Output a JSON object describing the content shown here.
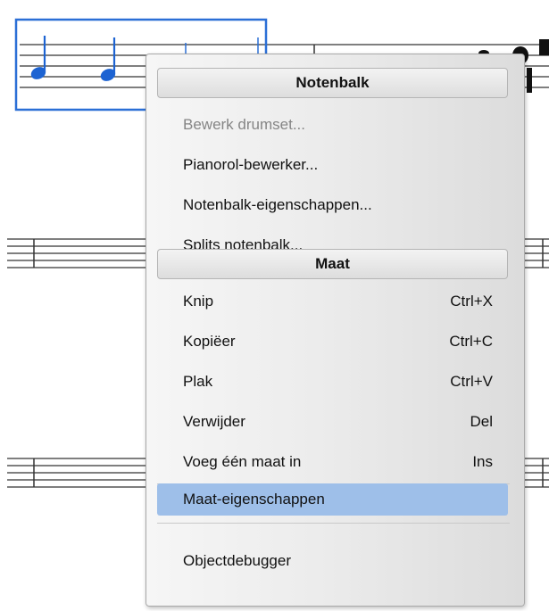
{
  "context_menu": {
    "staff_header": "Notenbalk",
    "staff_items": [
      {
        "label": "Bewerk drumset...",
        "disabled": true
      },
      {
        "label": "Pianorol-bewerker..."
      },
      {
        "label": "Notenbalk-eigenschappen..."
      },
      {
        "label": "Splits notenbalk..."
      }
    ],
    "measure_header": "Maat",
    "measure_items": [
      {
        "label": "Knip",
        "shortcut": "Ctrl+X"
      },
      {
        "label": "Kopiëer",
        "shortcut": "Ctrl+C"
      },
      {
        "label": "Plak",
        "shortcut": "Ctrl+V"
      },
      {
        "label": "Verwijder",
        "shortcut": "Del"
      },
      {
        "label": "Voeg één maat in",
        "shortcut": "Ins"
      }
    ],
    "properties_item": {
      "label": "Maat-eigenschappen",
      "highlighted": true
    },
    "debug_item": {
      "label": "Objectdebugger"
    }
  },
  "colors": {
    "selection": "#2b6fd6",
    "note": "#1d63d2",
    "highlight": "#9ebfe9"
  }
}
